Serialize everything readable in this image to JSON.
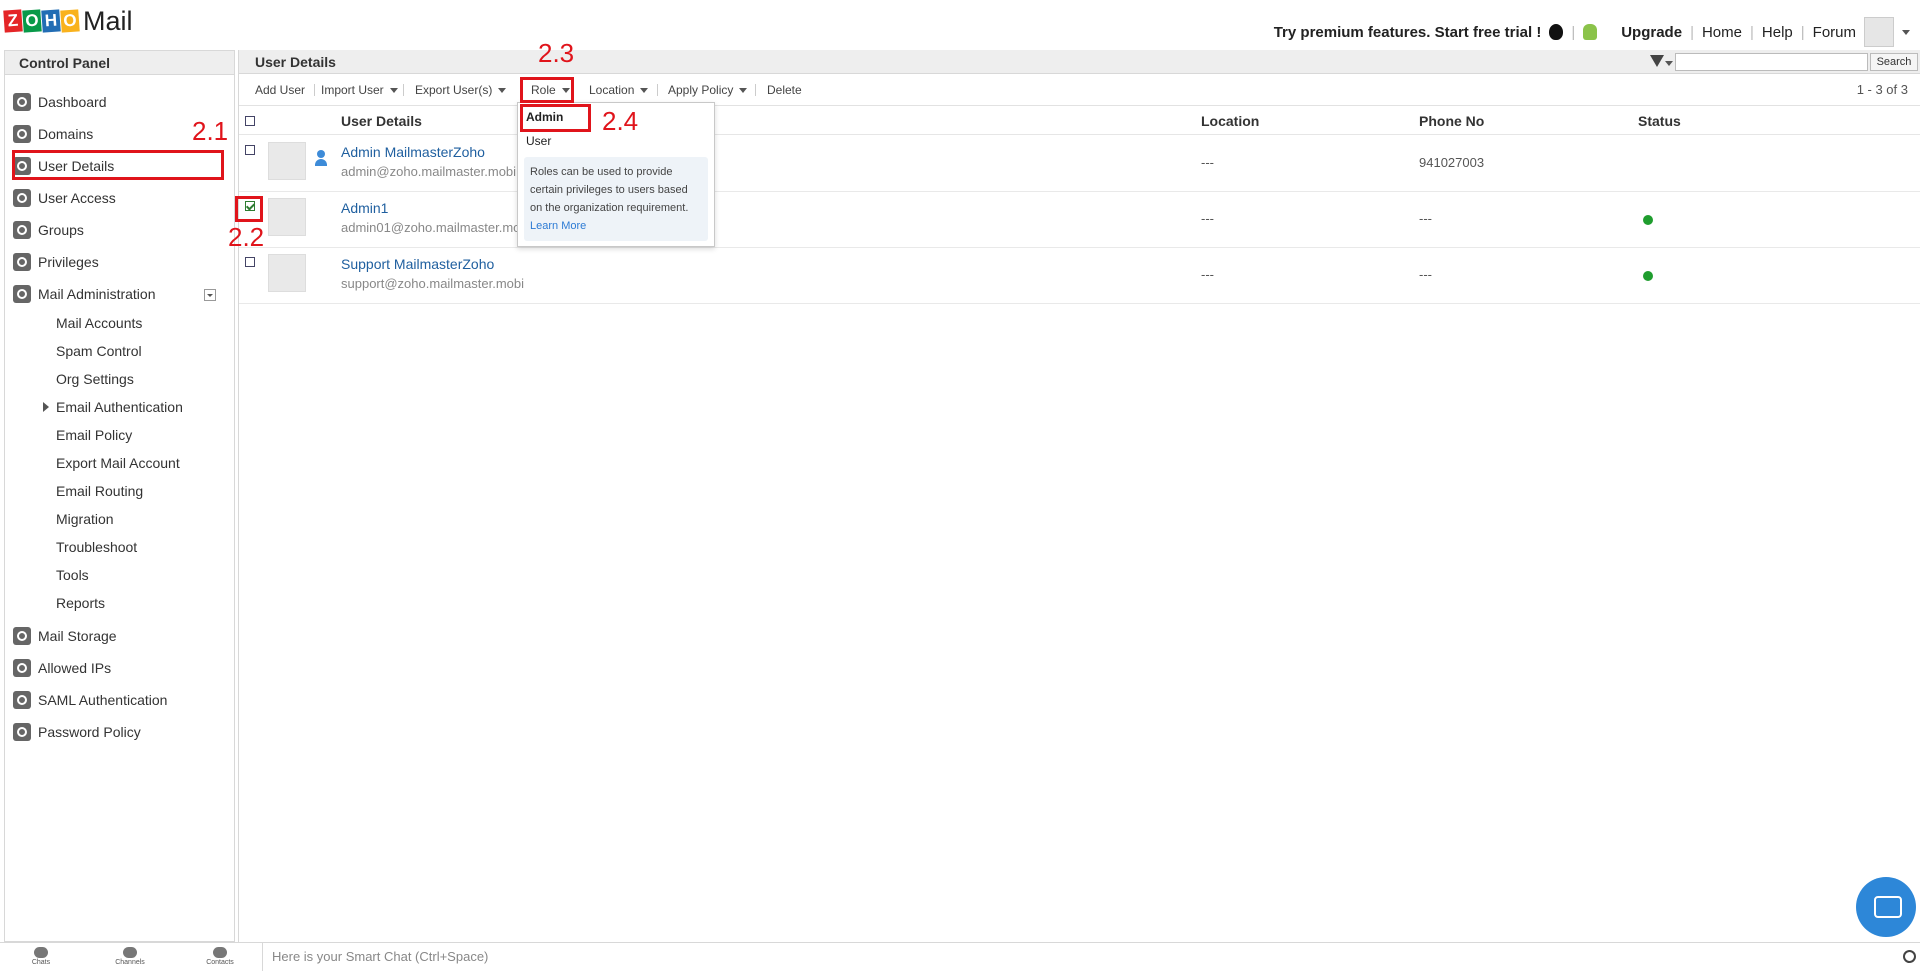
{
  "app": {
    "logo_text": "Mail",
    "logo_letters": [
      "Z",
      "O",
      "H",
      "O"
    ],
    "promo": "Try premium features. Start free trial !",
    "upgrade": "Upgrade",
    "home": "Home",
    "help": "Help",
    "forum": "Forum"
  },
  "sidebar": {
    "title": "Control Panel",
    "items": [
      {
        "label": "Dashboard",
        "icon": "dashboard-icon"
      },
      {
        "label": "Domains",
        "icon": "domains-icon"
      },
      {
        "label": "User Details",
        "icon": "user-details-icon"
      },
      {
        "label": "User Access",
        "icon": "user-access-icon"
      },
      {
        "label": "Groups",
        "icon": "groups-icon"
      },
      {
        "label": "Privileges",
        "icon": "privileges-icon"
      },
      {
        "label": "Mail Administration",
        "icon": "mail-icon"
      }
    ],
    "sub_items": [
      "Mail Accounts",
      "Spam Control",
      "Org Settings",
      "Email Authentication",
      "Email Policy",
      "Export Mail Account",
      "Email Routing",
      "Migration",
      "Troubleshoot",
      "Tools",
      "Reports"
    ],
    "bottom_items": [
      {
        "label": "Mail Storage",
        "icon": "storage-icon"
      },
      {
        "label": "Allowed IPs",
        "icon": "allowed-ips-icon"
      },
      {
        "label": "SAML Authentication",
        "icon": "saml-icon"
      },
      {
        "label": "Password Policy",
        "icon": "lock-icon"
      }
    ]
  },
  "main": {
    "title": "User Details",
    "search_button": "Search",
    "search_placeholder": "",
    "toolbar": {
      "add_user": "Add User",
      "import_user": "Import User",
      "export_users": "Export User(s)",
      "role": "Role",
      "location": "Location",
      "apply_policy": "Apply Policy",
      "delete": "Delete"
    },
    "pager": "1 - 3 of 3",
    "columns": {
      "user_details": "User Details",
      "location": "Location",
      "phone": "Phone No",
      "status": "Status"
    },
    "rows": [
      {
        "name": "Admin MailmasterZoho",
        "email": "admin@zoho.mailmaster.mobi",
        "location": "---",
        "phone": "941027003",
        "checked": false,
        "status": ""
      },
      {
        "name": "Admin1",
        "email": "admin01@zoho.mailmaster.mo",
        "location": "---",
        "phone": "---",
        "checked": true,
        "status": "active"
      },
      {
        "name": "Support MailmasterZoho",
        "email": "support@zoho.mailmaster.mobi",
        "location": "---",
        "phone": "---",
        "checked": false,
        "status": "active"
      }
    ]
  },
  "role_menu": {
    "options": [
      "Admin",
      "User"
    ],
    "info": "Roles can be used to provide certain privileges to users based on the organization requirement.",
    "learn_more_1": "Learn",
    "learn_more_2": "More"
  },
  "annotations": {
    "a21": "2.1",
    "a22": "2.2",
    "a23": "2.3",
    "a24": "2.4"
  },
  "chatbar": {
    "chats": "Chats",
    "channels": "Channels",
    "contacts": "Contacts",
    "placeholder": "Here is your Smart Chat (Ctrl+Space)"
  },
  "colors": {
    "annotation": "#e0141b",
    "link": "#1f5f9f",
    "status_active": "#1f9d2e"
  }
}
